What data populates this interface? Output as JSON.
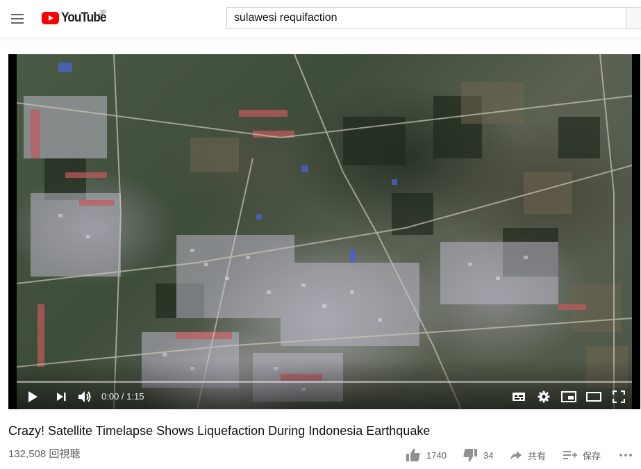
{
  "masthead": {
    "logo_text": "YouTube",
    "country_code": "JP",
    "search_value": "sulawesi requifaction"
  },
  "player": {
    "time_current": "0:00",
    "time_separator": " / ",
    "time_duration": "1:15",
    "progress": 0
  },
  "video": {
    "title": "Crazy! Satellite Timelapse Shows Liquefaction During Indonesia Earthquake",
    "views": "132,508 回視聴"
  },
  "actions": {
    "like_count": "1740",
    "dislike_count": "34",
    "share_label": "共有",
    "save_label": "保存"
  },
  "colors": {
    "brand_red": "#ff0000",
    "icon_grey": "#909090"
  }
}
